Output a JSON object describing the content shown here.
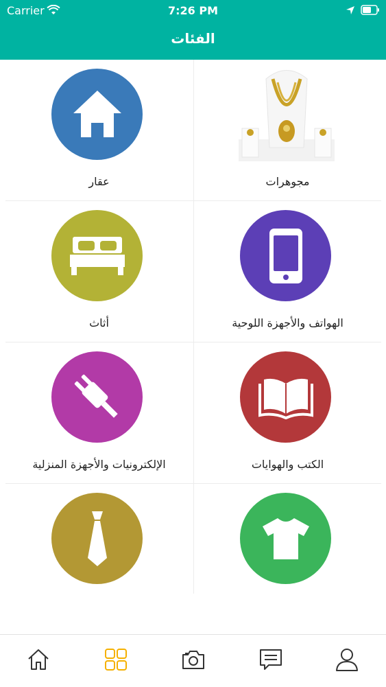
{
  "status": {
    "carrier": "Carrier",
    "time": "7:26 PM"
  },
  "header": {
    "title": "الفئات"
  },
  "categories": [
    {
      "label": "مجوهرات",
      "icon": "necklace-image",
      "color": "#ffffff"
    },
    {
      "label": "عقار",
      "icon": "house-icon",
      "color": "#3a7ab9"
    },
    {
      "label": "الهواتف والأجهزة اللوحية",
      "icon": "phone-icon",
      "color": "#5c3fb6"
    },
    {
      "label": "أثاث",
      "icon": "bed-icon",
      "color": "#b3b236"
    },
    {
      "label": "الكتب والهوايات",
      "icon": "book-icon",
      "color": "#b3383a"
    },
    {
      "label": "الإلكترونيات والأجهزة المنزلية",
      "icon": "plug-icon",
      "color": "#b23aa7"
    },
    {
      "label": "",
      "icon": "tshirt-icon",
      "color": "#3bb55b"
    },
    {
      "label": "",
      "icon": "tie-icon",
      "color": "#b39834"
    }
  ],
  "tabbar": {
    "items": [
      "home-icon",
      "grid-icon",
      "camera-icon",
      "chat-icon",
      "profile-icon"
    ],
    "active_color": "#f5b000",
    "inactive_color": "#333333"
  }
}
